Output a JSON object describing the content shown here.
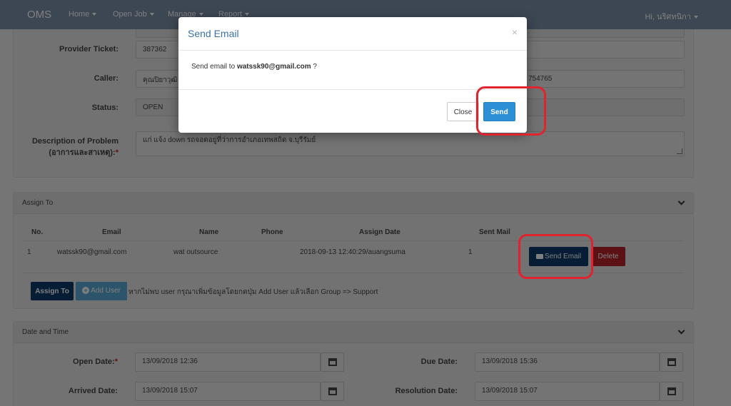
{
  "navbar": {
    "brand": "OMS",
    "items": [
      "Home",
      "Open Job",
      "Manage",
      "Report"
    ],
    "user": "Hi, นริศทนิกา"
  },
  "ticket": {
    "provider_ticket_label": "Provider Ticket:",
    "provider_ticket_value": "387362",
    "caller_label": "Caller:",
    "caller_value": "คุณปิยาวุฒิ",
    "caller_phone_partial": "754765",
    "status_label": "Status:",
    "status_value": "OPEN",
    "description_label_line1": "Description of Problem",
    "description_label_line2": "(อาการและสาเหตุ):",
    "required_mark": "*",
    "description_value": "แก่ แจ้ง down รถจอดอยู่ที่ว่าการอำเภอเทพสถิต จ.บุรีรัมย์"
  },
  "assign_panel": {
    "title": "Assign To",
    "columns": [
      "No.",
      "Email",
      "Name",
      "Phone",
      "Assign Date",
      "Sent Mail"
    ],
    "rows": [
      {
        "no": "1",
        "email": "watssk90@gmail.com",
        "name": "wat outsource",
        "phone": "",
        "assign_date": "2018-09-13 12:40:29/auangsuma",
        "sent_mail": "1"
      }
    ],
    "send_email_label": "Send Email",
    "delete_label": "Delete",
    "assign_to_label": "Assign To",
    "add_user_label": "Add User",
    "hint": "หากไม่พบ user กรุณาเพิ่มข้อมูลโดยกดปุ่ม Add User แล้วเลือก Group => Support"
  },
  "date_panel": {
    "title": "Date and Time",
    "open_date_label": "Open Date:",
    "open_date_value": "13/09/2018 12:36",
    "due_date_label": "Due Date:",
    "due_date_value": "13/09/2018 15:36",
    "arrived_date_label": "Arrived Date:",
    "arrived_date_value": "13/09/2018 15:07",
    "resolution_date_label": "Resolution Date:",
    "resolution_date_value": "13/09/2018 15:07"
  },
  "modal": {
    "title": "Send Email",
    "close_x": "×",
    "body_prefix": "Send email to ",
    "body_email": "watssk90@gmail.com",
    "body_suffix": " ?",
    "close_label": "Close",
    "send_label": "Send"
  },
  "colors": {
    "navbar": "#7a8fa6",
    "primary_dark": "#0f3a6b",
    "danger": "#b8252a",
    "info": "#58a8d6",
    "send": "#2d8fd5",
    "highlight": "#e0232e"
  }
}
